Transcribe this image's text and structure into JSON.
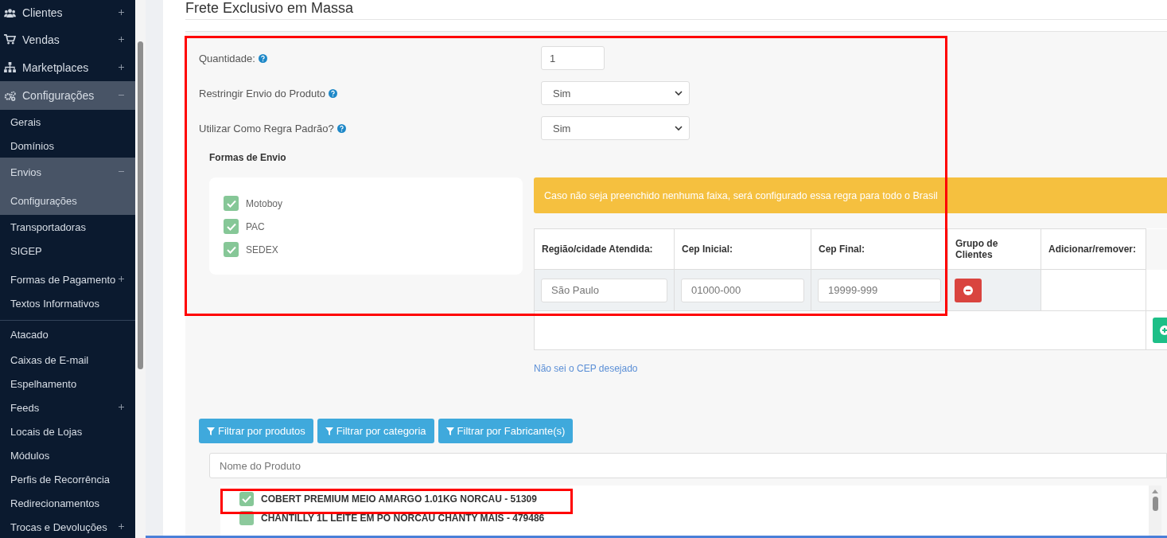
{
  "sidebar": {
    "items": [
      {
        "kind": "section",
        "label": "Clientes",
        "expanded": false,
        "selected": false,
        "separated": false
      },
      {
        "kind": "section",
        "label": "Vendas",
        "expanded": false,
        "selected": false,
        "separated": false
      },
      {
        "kind": "section",
        "label": "Marketplaces",
        "expanded": false,
        "selected": false,
        "separated": false
      },
      {
        "kind": "section",
        "label": "Configurações",
        "expanded": true,
        "selected": true,
        "separated": false
      },
      {
        "kind": "link",
        "label": "Gerais",
        "selected": false,
        "separated": false
      },
      {
        "kind": "link",
        "label": "Domínios",
        "selected": false,
        "separated": false
      },
      {
        "kind": "link",
        "label": "Envios",
        "expanded": true,
        "selected": true,
        "separated": false
      },
      {
        "kind": "link",
        "label": "Configurações",
        "selected": true,
        "separated": false
      },
      {
        "kind": "link",
        "label": "Transportadoras",
        "selected": false,
        "separated": false
      },
      {
        "kind": "link",
        "label": "SIGEP",
        "selected": false,
        "separated": false
      },
      {
        "kind": "link",
        "label": "Formas de Pagamento",
        "expanded": false,
        "selected": false,
        "separated": false
      },
      {
        "kind": "link",
        "label": "Textos Informativos",
        "selected": false,
        "separated": false
      },
      {
        "kind": "link",
        "label": "Atacado",
        "selected": false,
        "separated": true
      },
      {
        "kind": "link",
        "label": "Caixas de E-mail",
        "selected": false,
        "separated": false
      },
      {
        "kind": "link",
        "label": "Espelhamento",
        "selected": false,
        "separated": false
      },
      {
        "kind": "link",
        "label": "Feeds",
        "expanded": false,
        "selected": false,
        "separated": false
      },
      {
        "kind": "link",
        "label": "Locais de Lojas",
        "selected": false,
        "separated": false
      },
      {
        "kind": "link",
        "label": "Módulos",
        "selected": false,
        "separated": false
      },
      {
        "kind": "link",
        "label": "Perfis de Recorrência",
        "selected": false,
        "separated": false
      },
      {
        "kind": "link",
        "label": "Redirecionamentos",
        "selected": false,
        "separated": false
      },
      {
        "kind": "link",
        "label": "Trocas e Devoluções",
        "expanded": false,
        "selected": false,
        "separated": false
      }
    ]
  },
  "page": {
    "title": "Frete Exclusivo em Massa"
  },
  "form": {
    "fields": [
      {
        "kind": "input",
        "label": "Quantidade:",
        "value": "1"
      },
      {
        "kind": "select",
        "label": "Restringir Envio do Produto",
        "value": "Sim"
      },
      {
        "kind": "select",
        "label": "Utilizar Como Regra Padrão?",
        "value": "Sim"
      }
    ]
  },
  "shipping_methods": {
    "title": "Formas de Envio",
    "options": [
      {
        "label": "Motoboy",
        "checked": true
      },
      {
        "label": "PAC",
        "checked": true
      },
      {
        "label": "SEDEX",
        "checked": true
      }
    ]
  },
  "alert": "Caso não seja preenchido nenhuma faixa, será configurado essa regra para todo o Brasil",
  "ranges": {
    "columns": [
      "Região/cidade Atendida:",
      "Cep Inicial:",
      "Cep Final:",
      "Grupo de Clientes",
      "Adicionar/remover:"
    ],
    "rows": [
      {
        "region": {
          "placeholder": "São Paulo"
        },
        "cep_start": {
          "placeholder": "01000-000"
        },
        "cep_end": {
          "placeholder": "19999-999"
        }
      }
    ],
    "help_link": "Não sei o CEP desejado"
  },
  "filters": [
    "Filtrar por produtos",
    "Filtrar por categoria",
    "Filtrar por Fabricante(s)"
  ],
  "product_search": {
    "placeholder": "Nome do Produto"
  },
  "products": [
    {
      "label": "COBERT PREMIUM MEIO AMARGO 1.01KG NORCAU - 51309",
      "checked": true
    },
    {
      "label": "CHANTILLY 1L LEITE EM PO NORCAU CHANTY MAIS - 479486",
      "checked": false
    }
  ]
}
